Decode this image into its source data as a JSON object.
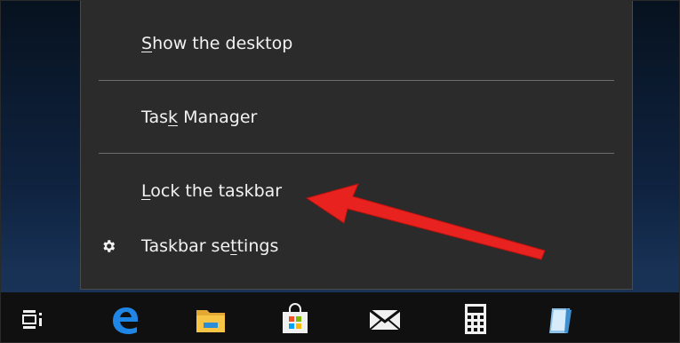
{
  "context_menu": {
    "items": [
      {
        "before": "",
        "accel": "S",
        "after": "how the desktop"
      },
      {
        "before": "Tas",
        "accel": "k",
        "after": " Manager"
      },
      {
        "before": "",
        "accel": "L",
        "after": "ock the taskbar"
      },
      {
        "before": "Taskbar se",
        "accel": "t",
        "after": "tings",
        "icon": "gear-icon"
      }
    ]
  },
  "taskbar": {
    "icons": [
      "task-view-icon",
      "edge-browser-icon",
      "file-explorer-icon",
      "store-icon",
      "mail-icon",
      "calculator-icon",
      "notepad-icon"
    ]
  },
  "annotation": {
    "color": "#e8231f",
    "points_to": "lock-the-taskbar"
  },
  "colors": {
    "menu_bg": "#2b2b2b",
    "taskbar_bg": "#101010",
    "text": "#f2f2f2",
    "separator": "#6d6d6d"
  }
}
